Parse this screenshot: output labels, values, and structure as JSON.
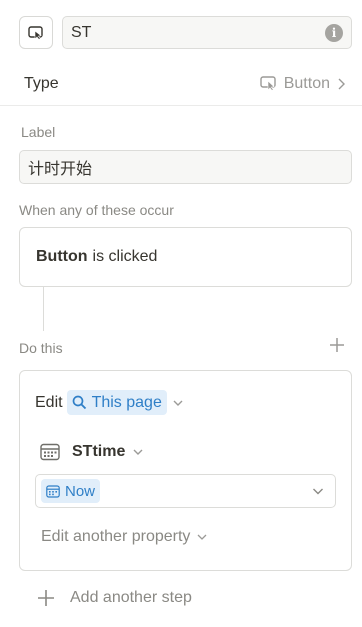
{
  "header": {
    "name_value": "ST"
  },
  "type_row": {
    "label": "Type",
    "value": "Button"
  },
  "label_section": {
    "label": "Label",
    "value": "计时开始"
  },
  "trigger_section": {
    "heading": "When any of these occur",
    "subject": "Button",
    "predicate": "is clicked"
  },
  "action_section": {
    "heading": "Do this",
    "edit_verb": "Edit",
    "target": "This page",
    "property_name": "STtime",
    "property_value": "Now",
    "edit_another": "Edit another property",
    "add_step": "Add another step"
  },
  "colors": {
    "accent_text": "#2f7fc7",
    "accent_bg": "#e1eefa",
    "muted": "#8a8984"
  }
}
